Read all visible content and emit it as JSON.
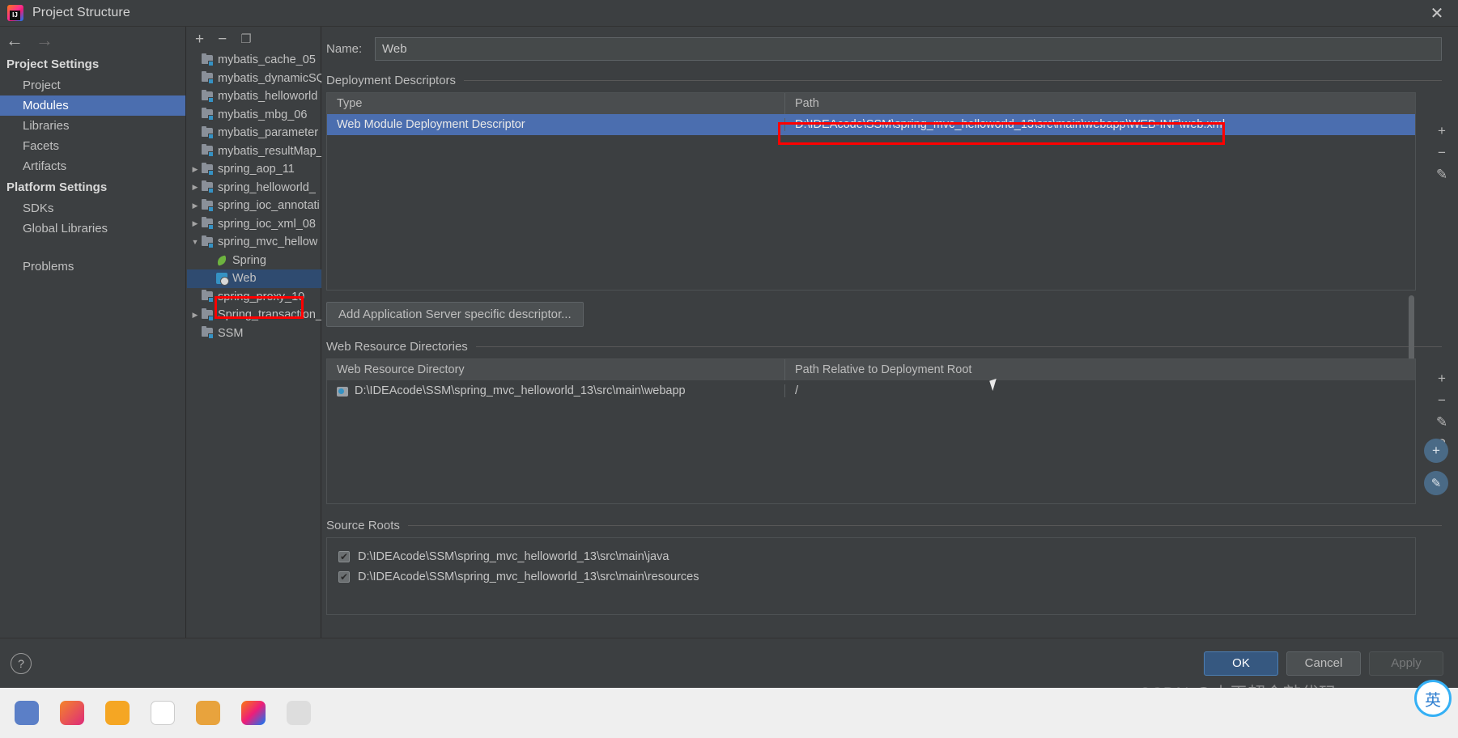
{
  "window": {
    "title": "Project Structure",
    "close_label": "✕",
    "logo_icon": "intellij-idea-logo"
  },
  "nav": {
    "back_icon": "arrow-left-icon",
    "forward_icon": "arrow-right-icon"
  },
  "sidebar": {
    "groups": [
      {
        "label": "Project Settings",
        "items": [
          {
            "label": "Project",
            "selected": false
          },
          {
            "label": "Modules",
            "selected": true
          },
          {
            "label": "Libraries",
            "selected": false
          },
          {
            "label": "Facets",
            "selected": false
          },
          {
            "label": "Artifacts",
            "selected": false
          }
        ]
      },
      {
        "label": "Platform Settings",
        "items": [
          {
            "label": "SDKs",
            "selected": false
          },
          {
            "label": "Global Libraries",
            "selected": false
          }
        ]
      }
    ],
    "problems_label": "Problems"
  },
  "tree_toolbar": {
    "add_label": "+",
    "remove_label": "−",
    "copy_label": "❐"
  },
  "module_tree": [
    {
      "label": "mybatis_cache_05",
      "icon": "module-icon",
      "twisty": "",
      "indent": 0,
      "selected": false
    },
    {
      "label": "mybatis_dynamicSQ",
      "icon": "module-icon",
      "twisty": "",
      "indent": 0,
      "selected": false
    },
    {
      "label": "mybatis_helloworld",
      "icon": "module-icon",
      "twisty": "",
      "indent": 0,
      "selected": false
    },
    {
      "label": "mybatis_mbg_06",
      "icon": "module-icon",
      "twisty": "",
      "indent": 0,
      "selected": false
    },
    {
      "label": "mybatis_parameter",
      "icon": "module-icon",
      "twisty": "",
      "indent": 0,
      "selected": false
    },
    {
      "label": "mybatis_resultMap_",
      "icon": "module-icon",
      "twisty": "",
      "indent": 0,
      "selected": false
    },
    {
      "label": "spring_aop_11",
      "icon": "module-icon",
      "twisty": "▶",
      "indent": 0,
      "selected": false
    },
    {
      "label": "spring_helloworld_",
      "icon": "module-icon",
      "twisty": "▶",
      "indent": 0,
      "selected": false
    },
    {
      "label": "spring_ioc_annotati",
      "icon": "module-icon",
      "twisty": "▶",
      "indent": 0,
      "selected": false
    },
    {
      "label": "spring_ioc_xml_08",
      "icon": "module-icon",
      "twisty": "▶",
      "indent": 0,
      "selected": false
    },
    {
      "label": "spring_mvc_hellow",
      "icon": "module-icon",
      "twisty": "▼",
      "indent": 0,
      "selected": false
    },
    {
      "label": "Spring",
      "icon": "spring-leaf-icon",
      "twisty": "",
      "indent": 1,
      "selected": false
    },
    {
      "label": "Web",
      "icon": "web-facet-icon",
      "twisty": "",
      "indent": 1,
      "selected": true
    },
    {
      "label": "spring_proxy_10",
      "icon": "module-icon",
      "twisty": "",
      "indent": 0,
      "selected": false
    },
    {
      "label": "Spring_transaction_",
      "icon": "module-icon",
      "twisty": "▶",
      "indent": 0,
      "selected": false
    },
    {
      "label": "SSM",
      "icon": "module-icon",
      "twisty": "",
      "indent": 0,
      "selected": false
    }
  ],
  "form": {
    "name_label": "Name:",
    "name_value": "Web",
    "name_placeholder": ""
  },
  "deployment_descriptors": {
    "section_label": "Deployment Descriptors",
    "columns": [
      "Type",
      "Path"
    ],
    "rows": [
      {
        "type": "Web Module Deployment Descriptor",
        "path": "D:\\IDEAcode\\SSM\\spring_mvc_helloworld_13\\src\\main\\webapp\\WEB-INF\\web.xml",
        "selected": true
      }
    ],
    "side_buttons": [
      {
        "name": "add-descriptor-button",
        "label": "+"
      },
      {
        "name": "remove-descriptor-button",
        "label": "−"
      },
      {
        "name": "edit-descriptor-button",
        "label": "✎"
      }
    ],
    "add_server_descriptor_button": "Add Application Server specific descriptor..."
  },
  "web_resource_directories": {
    "section_label": "Web Resource Directories",
    "columns": [
      "Web Resource Directory",
      "Path Relative to Deployment Root"
    ],
    "rows": [
      {
        "directory": "D:\\IDEAcode\\SSM\\spring_mvc_helloworld_13\\src\\main\\webapp",
        "relative": "/"
      }
    ],
    "side_buttons": [
      {
        "name": "add-web-resource-button",
        "label": "+"
      },
      {
        "name": "remove-web-resource-button",
        "label": "−"
      },
      {
        "name": "edit-web-resource-button",
        "label": "✎"
      },
      {
        "name": "help-web-resource-button",
        "label": "?"
      }
    ]
  },
  "source_roots": {
    "section_label": "Source Roots",
    "items": [
      {
        "label": "D:\\IDEAcode\\SSM\\spring_mvc_helloworld_13\\src\\main\\java",
        "checked": true
      },
      {
        "label": "D:\\IDEAcode\\SSM\\spring_mvc_helloworld_13\\src\\main\\resources",
        "checked": true
      }
    ]
  },
  "footer": {
    "help_label": "?",
    "ok_label": "OK",
    "cancel_label": "Cancel",
    "apply_label": "Apply"
  },
  "overlay": {
    "watermark": "CSDN @小王超会敲代码",
    "ime_label": "英"
  },
  "colors": {
    "accent_blue": "#4b6eaf",
    "ok_button": "#365880",
    "annotation_red": "#ff0000",
    "panel_bg": "#3c3f41",
    "facet_blue": "#3592c4",
    "spring_green": "#6db33f"
  }
}
